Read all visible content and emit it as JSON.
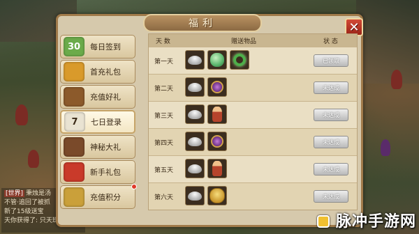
{
  "window": {
    "title": "福利",
    "close_glyph": "✕"
  },
  "side_menu": [
    {
      "label": "每日签到",
      "icon": "calendar-icon",
      "icon_text": "30",
      "color": "#6bab4a"
    },
    {
      "label": "首充礼包",
      "icon": "gold-pot-icon",
      "icon_text": "",
      "color": "#d99a2b"
    },
    {
      "label": "充值好礼",
      "icon": "treasure-chest-icon",
      "icon_text": "",
      "color": "#8c5a2b"
    },
    {
      "label": "七日登录",
      "icon": "calendar-seven-icon",
      "icon_text": "7",
      "color": "#e9e3d2",
      "active": true
    },
    {
      "label": "神秘大礼",
      "icon": "mystery-chest-icon",
      "icon_text": "",
      "color": "#7a4a2a"
    },
    {
      "label": "新手礼包",
      "icon": "gift-box-icon",
      "icon_text": "",
      "color": "#c93a2a"
    },
    {
      "label": "充值积分",
      "icon": "coin-bag-icon",
      "icon_text": "",
      "color": "#caa03a",
      "badge": true
    }
  ],
  "table": {
    "headers": {
      "day": "天 数",
      "gifts": "赠送物品",
      "status": "状 态"
    },
    "rows": [
      {
        "day": "第一天",
        "gifts": [
          "silver-ingot-icon",
          "green-pet-icon",
          "jade-ring-icon"
        ],
        "status": "已领取"
      },
      {
        "day": "第二天",
        "gifts": [
          "silver-ingot-icon",
          "purple-medal-icon"
        ],
        "status": "未达成"
      },
      {
        "day": "第三天",
        "gifts": [
          "silver-ingot-icon",
          "doll-icon"
        ],
        "status": "未达成"
      },
      {
        "day": "第四天",
        "gifts": [
          "silver-ingot-icon",
          "purple-medal-icon"
        ],
        "status": "未达成"
      },
      {
        "day": "第五天",
        "gifts": [
          "silver-ingot-icon",
          "doll-icon"
        ],
        "status": "未达成"
      },
      {
        "day": "第六天",
        "gifts": [
          "silver-ingot-icon",
          "golden-bull-icon"
        ],
        "status": "未达成"
      }
    ]
  },
  "chat": {
    "lines": [
      {
        "tag": "[世界]",
        "text": "秉烛是汤"
      },
      {
        "tag": "",
        "text": "不管·追回了被抓"
      },
      {
        "tag": "",
        "text": "新了15级送宝"
      },
      {
        "tag": "",
        "text": "天你获得了: 只天珠"
      }
    ]
  },
  "watermark": "脉冲手游网",
  "colors": {
    "panel": "#d6c9ac",
    "frame": "#a07a4a",
    "title_bar": "#9c7a4e",
    "close": "#c13a28"
  }
}
